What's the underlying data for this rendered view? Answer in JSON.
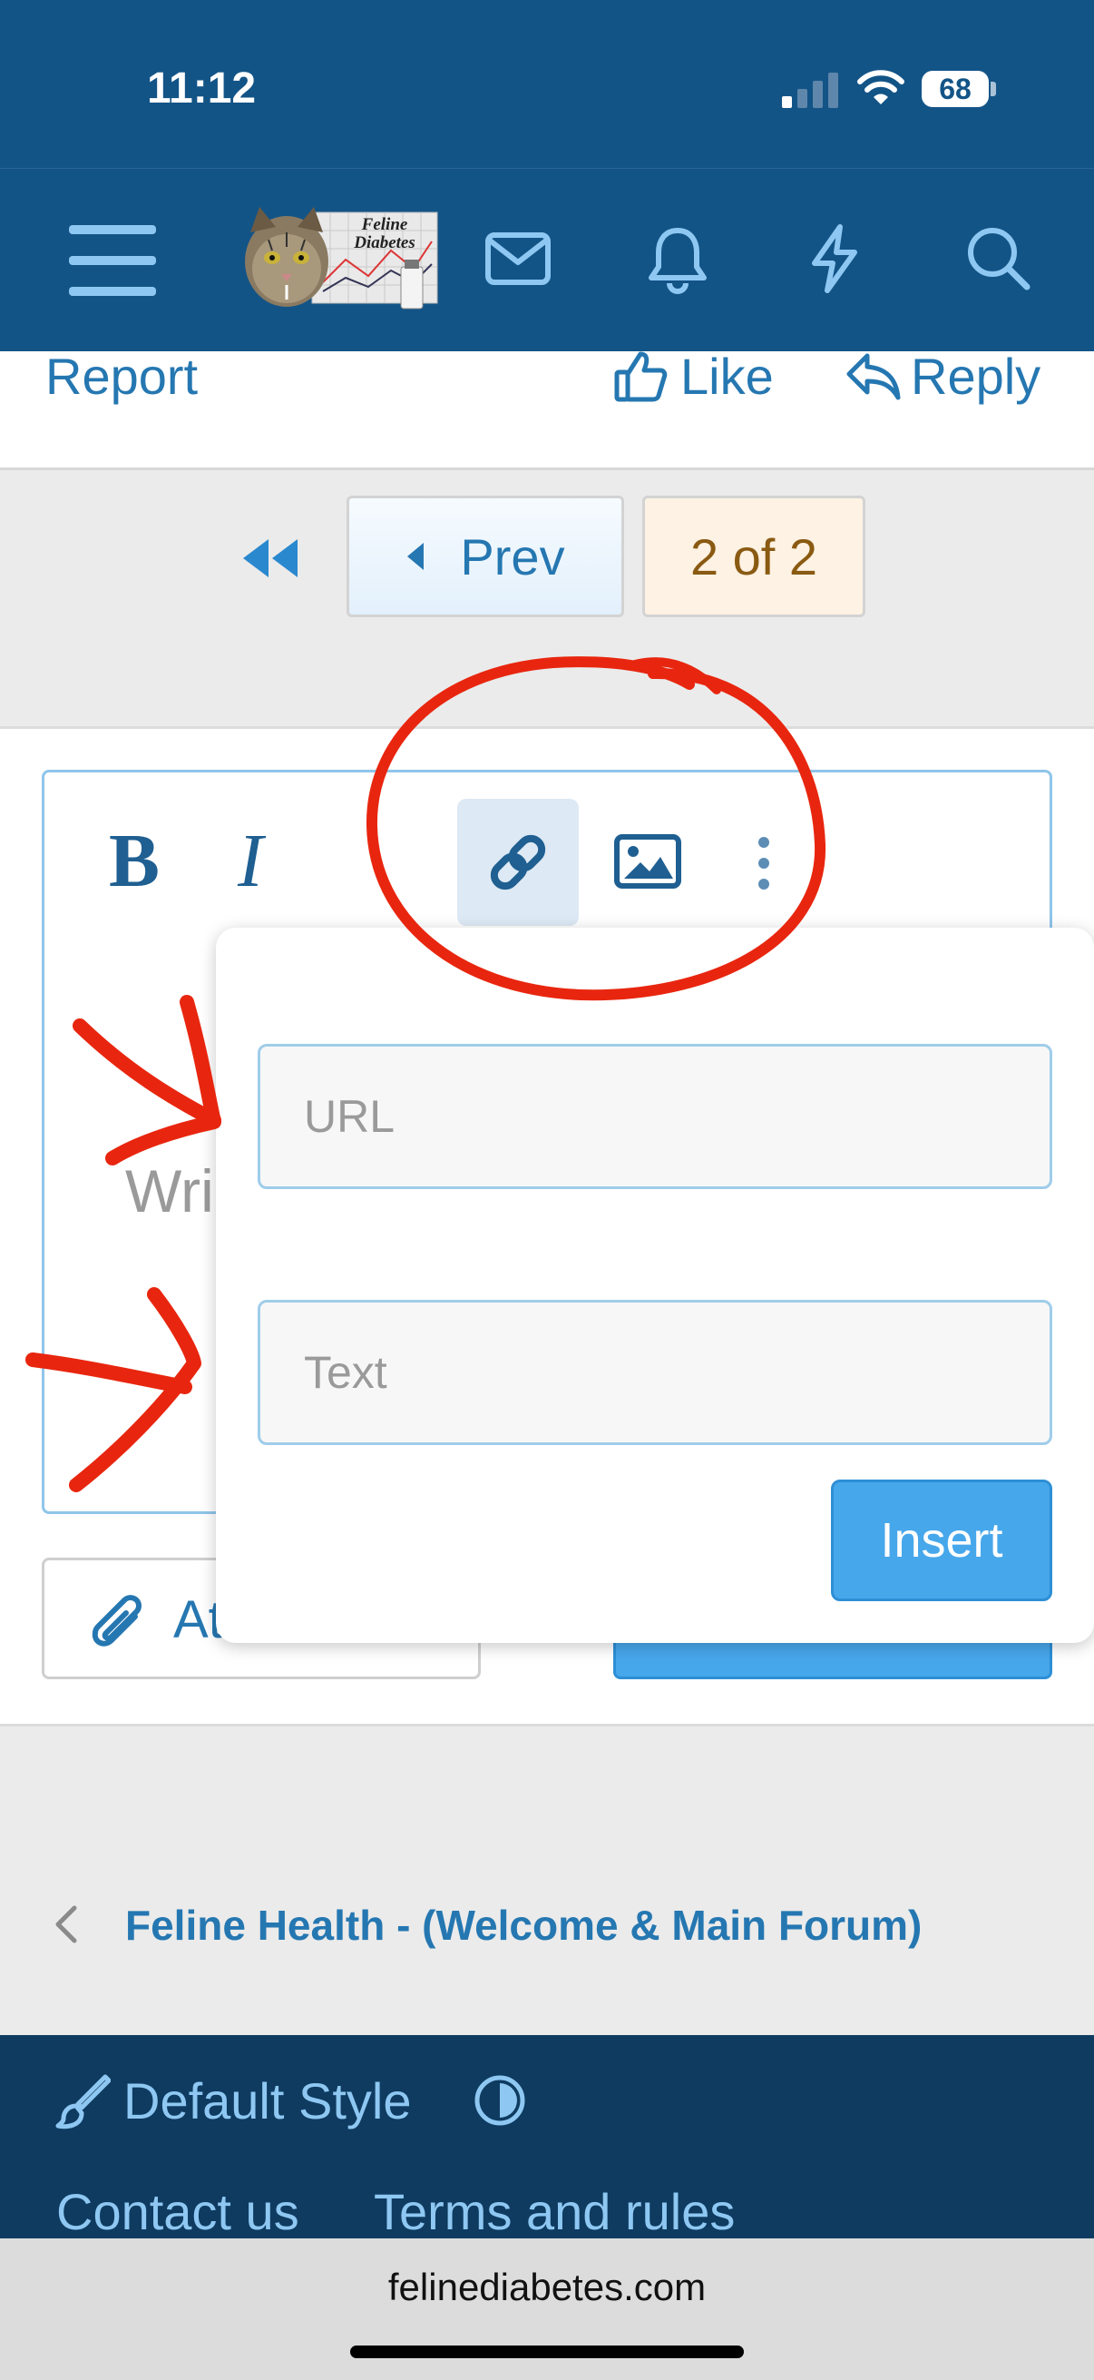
{
  "status_bar": {
    "time": "11:12",
    "battery": "68"
  },
  "navbar": {
    "logo_text_line1": "Feline",
    "logo_text_line2": "Diabetes",
    "icons": [
      "menu-icon",
      "mail-icon",
      "bell-icon",
      "bolt-icon",
      "search-icon"
    ]
  },
  "post_actions": {
    "report": "Report",
    "like": "Like",
    "reply": "Reply"
  },
  "pagination": {
    "prev": "Prev",
    "page": "2 of 2"
  },
  "editor": {
    "placeholder_visible": "Wri",
    "attach_visible": "At"
  },
  "link_popup": {
    "url_placeholder": "URL",
    "text_placeholder": "Text",
    "insert_label": "Insert"
  },
  "breadcrumb": {
    "label": "Feline Health - (Welcome & Main Forum)"
  },
  "footer": {
    "style_label": "Default Style",
    "contact": "Contact us",
    "terms": "Terms and rules"
  },
  "browser": {
    "url": "felinediabetes.com"
  },
  "colors": {
    "header_bg": "#135487",
    "link_blue": "#2577b1",
    "insert_blue": "#47a7eb",
    "annotation_red": "#e8260f"
  }
}
